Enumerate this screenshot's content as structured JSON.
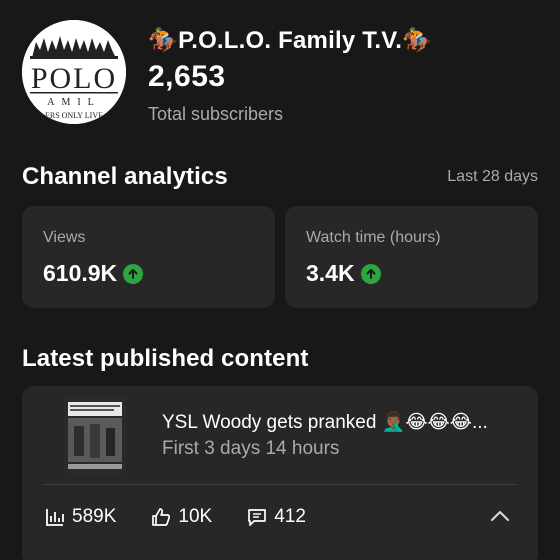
{
  "channel": {
    "name": "🏇P.O.L.O. Family  T.V.🏇",
    "subscribers": "2,653",
    "subscribers_label": "Total subscribers",
    "avatar_text_large": "POLO",
    "avatar_text_small": "AMIL",
    "avatar_text_footer": "ERS ONLY LIVE"
  },
  "analytics": {
    "title": "Channel analytics",
    "period": "Last 28 days",
    "cards": [
      {
        "label": "Views",
        "value": "610.9K",
        "trend": "up"
      },
      {
        "label": "Watch time (hours)",
        "value": "3.4K",
        "trend": "up"
      }
    ]
  },
  "latest": {
    "title": "Latest published content",
    "video_title": "YSL Woody gets pranked 🤦🏾‍♂️😂😂😂...",
    "video_subtitle": "First 3 days 14 hours",
    "stats": {
      "views": "589K",
      "likes": "10K",
      "comments": "412"
    }
  },
  "colors": {
    "background": "#181818",
    "card": "#272727",
    "muted": "#aaaaaa",
    "trend_up": "#2ba640"
  }
}
